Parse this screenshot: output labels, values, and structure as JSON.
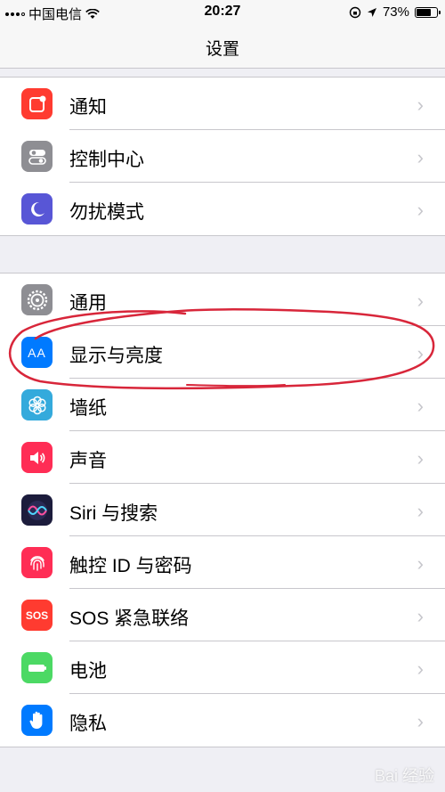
{
  "status_bar": {
    "carrier": "中国电信",
    "time": "20:27",
    "battery": "73%",
    "battery_level": 0.73
  },
  "nav": {
    "title": "设置"
  },
  "groups": [
    {
      "items": [
        {
          "label": "通知",
          "icon": "notification-icon",
          "color": "#ff3b30"
        },
        {
          "label": "控制中心",
          "icon": "control-center-icon",
          "color": "#8e8e93"
        },
        {
          "label": "勿扰模式",
          "icon": "moon-icon",
          "color": "#5856d6"
        }
      ]
    },
    {
      "items": [
        {
          "label": "通用",
          "icon": "gear-icon",
          "color": "#8e8e93"
        },
        {
          "label": "显示与亮度",
          "icon": "display-icon",
          "color": "#007aff"
        },
        {
          "label": "墙纸",
          "icon": "wallpaper-icon",
          "color": "#34aadc"
        },
        {
          "label": "声音",
          "icon": "speaker-icon",
          "color": "#ff2d55"
        },
        {
          "label": "Siri 与搜索",
          "icon": "siri-icon",
          "color": "#1c1c3c"
        },
        {
          "label": "触控 ID 与密码",
          "icon": "fingerprint-icon",
          "color": "#ff2d55"
        },
        {
          "label": "SOS 紧急联络",
          "icon": "sos-icon",
          "color": "#ff3b30"
        },
        {
          "label": "电池",
          "icon": "battery-icon",
          "color": "#4cd964"
        },
        {
          "label": "隐私",
          "icon": "hand-icon",
          "color": "#007aff"
        }
      ]
    }
  ],
  "icon_texts": {
    "display": "AA",
    "sos": "SOS"
  },
  "watermark": "Bai 经验"
}
